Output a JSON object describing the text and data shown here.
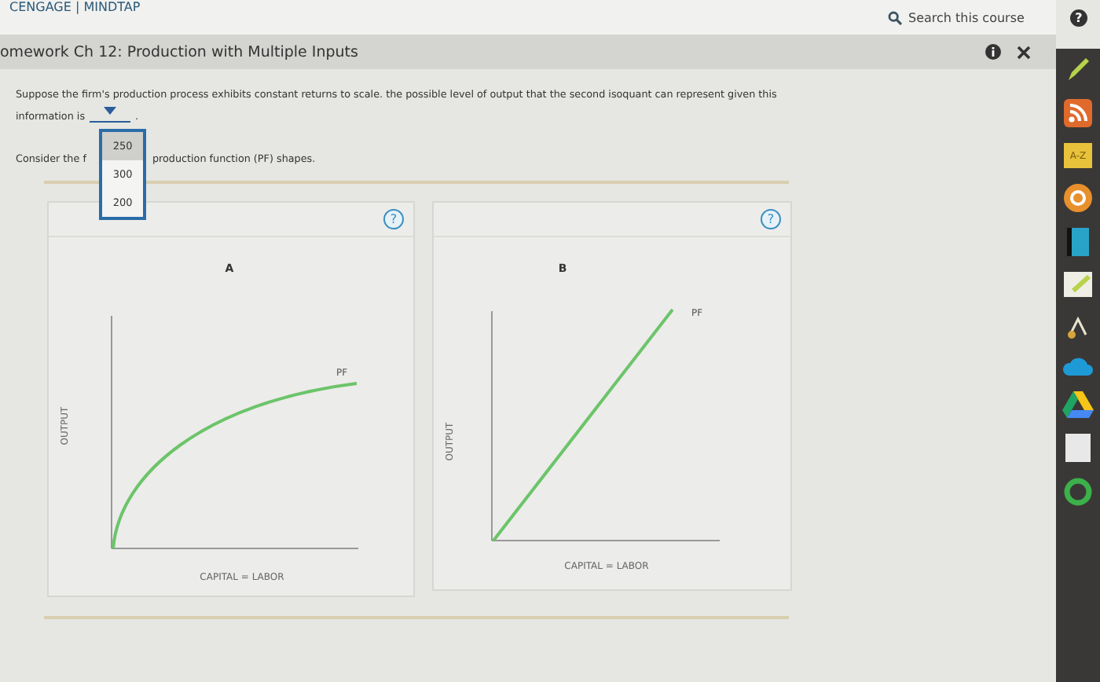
{
  "header": {
    "brand": "CENGAGE | MINDTAP",
    "search": {
      "placeholder": "Search this course"
    }
  },
  "assignment": {
    "title": "omework Ch 12: Production with Multiple Inputs"
  },
  "question": {
    "text": "Suppose the firm's production process exhibits constant returns to scale. the possible level of output that the second isoquant can represent given this",
    "continuation": "information is",
    "after": ".",
    "dropdown": {
      "expanded": true,
      "options": [
        {
          "label": "250",
          "selected": true
        },
        {
          "label": "300",
          "selected": false
        },
        {
          "label": "200",
          "selected": false
        }
      ]
    },
    "consider_start": "Consider the f",
    "consider_end": "production function (PF) shapes."
  },
  "graphs": [
    {
      "label": "A",
      "kind": "concave",
      "help": "?",
      "curve_label": "PF",
      "ylabel": "OUTPUT",
      "xlabel": "CAPITAL = LABOR"
    },
    {
      "label": "B",
      "kind": "linear",
      "help": "?",
      "curve_label": "PF",
      "ylabel": "OUTPUT",
      "xlabel": "CAPITAL = LABOR"
    }
  ],
  "sidebar": {
    "help": "?",
    "az_label": "A-Z"
  }
}
